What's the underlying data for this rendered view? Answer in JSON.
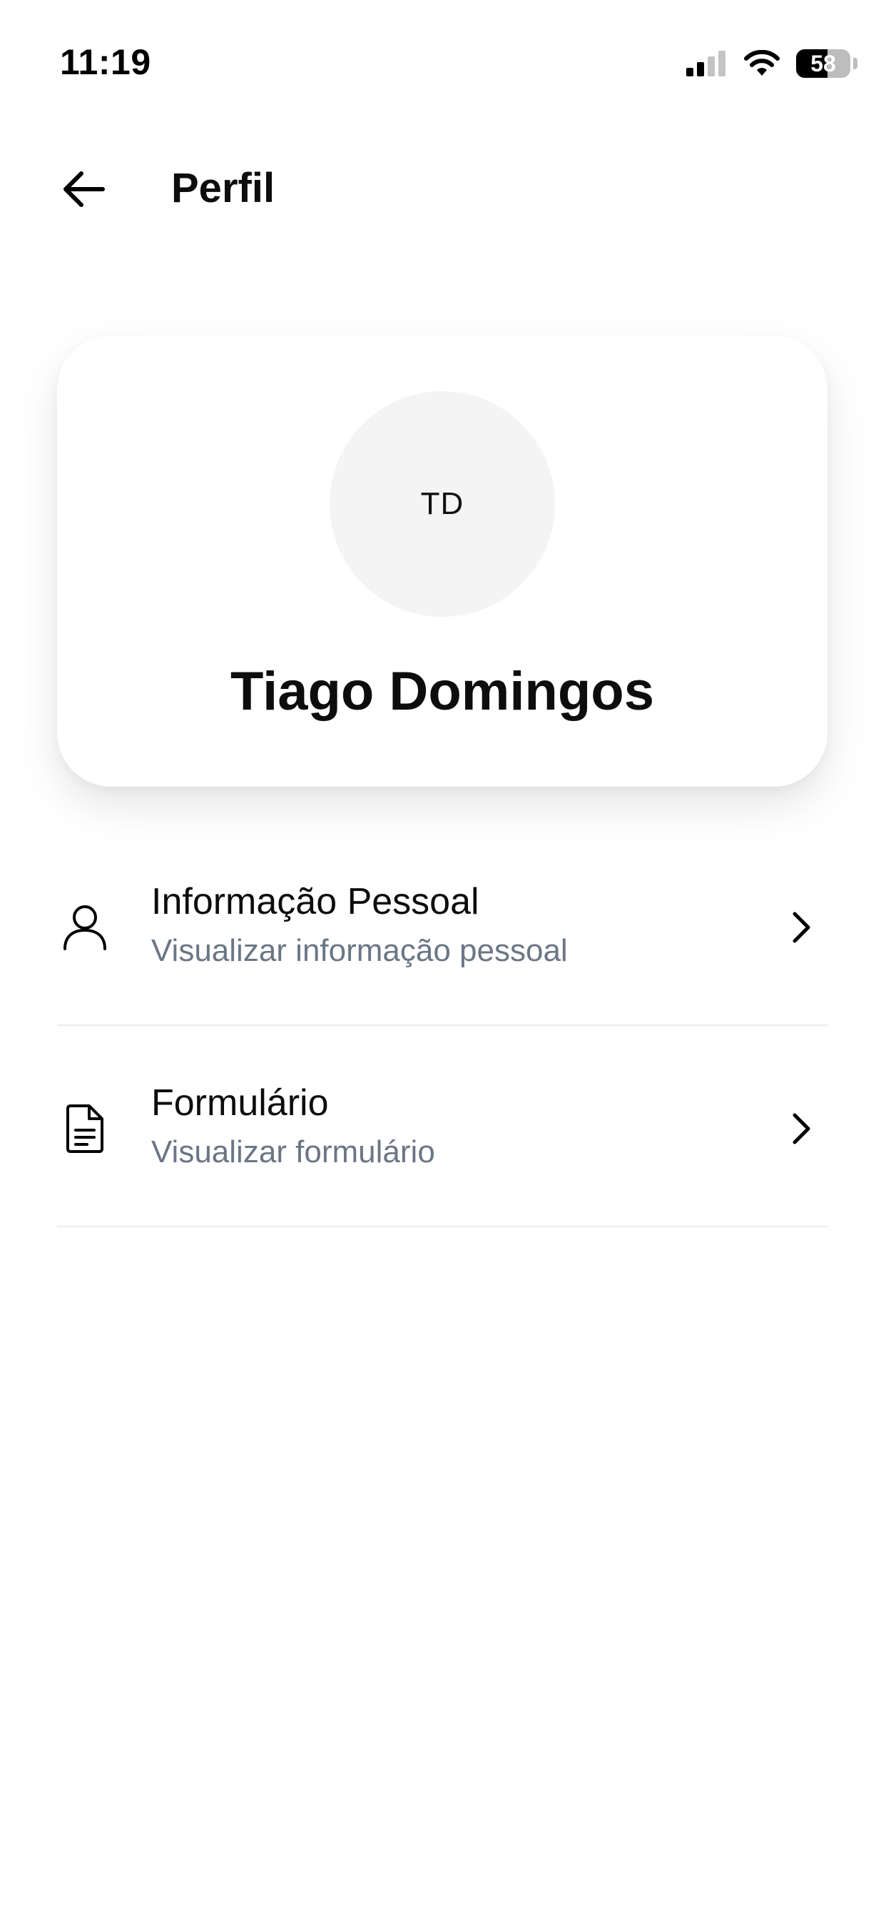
{
  "status_bar": {
    "time": "11:19",
    "battery_level": "58",
    "icons": [
      "signal-icon",
      "wifi-icon",
      "battery-icon"
    ]
  },
  "header": {
    "title": "Perfil",
    "back_icon": "arrow-left-icon"
  },
  "profile": {
    "initials": "TD",
    "name": "Tiago Domingos"
  },
  "menu": {
    "items": [
      {
        "title": "Informação Pessoal",
        "subtitle": "Visualizar informação pessoal",
        "icon": "user-icon"
      },
      {
        "title": "Formulário",
        "subtitle": "Visualizar formulário",
        "icon": "document-icon"
      }
    ]
  },
  "colors": {
    "background": "#ffffff",
    "text_primary": "#0d0d0d",
    "text_secondary": "#6b7685",
    "avatar_bg": "#f4f4f4",
    "divider": "#ececec"
  }
}
